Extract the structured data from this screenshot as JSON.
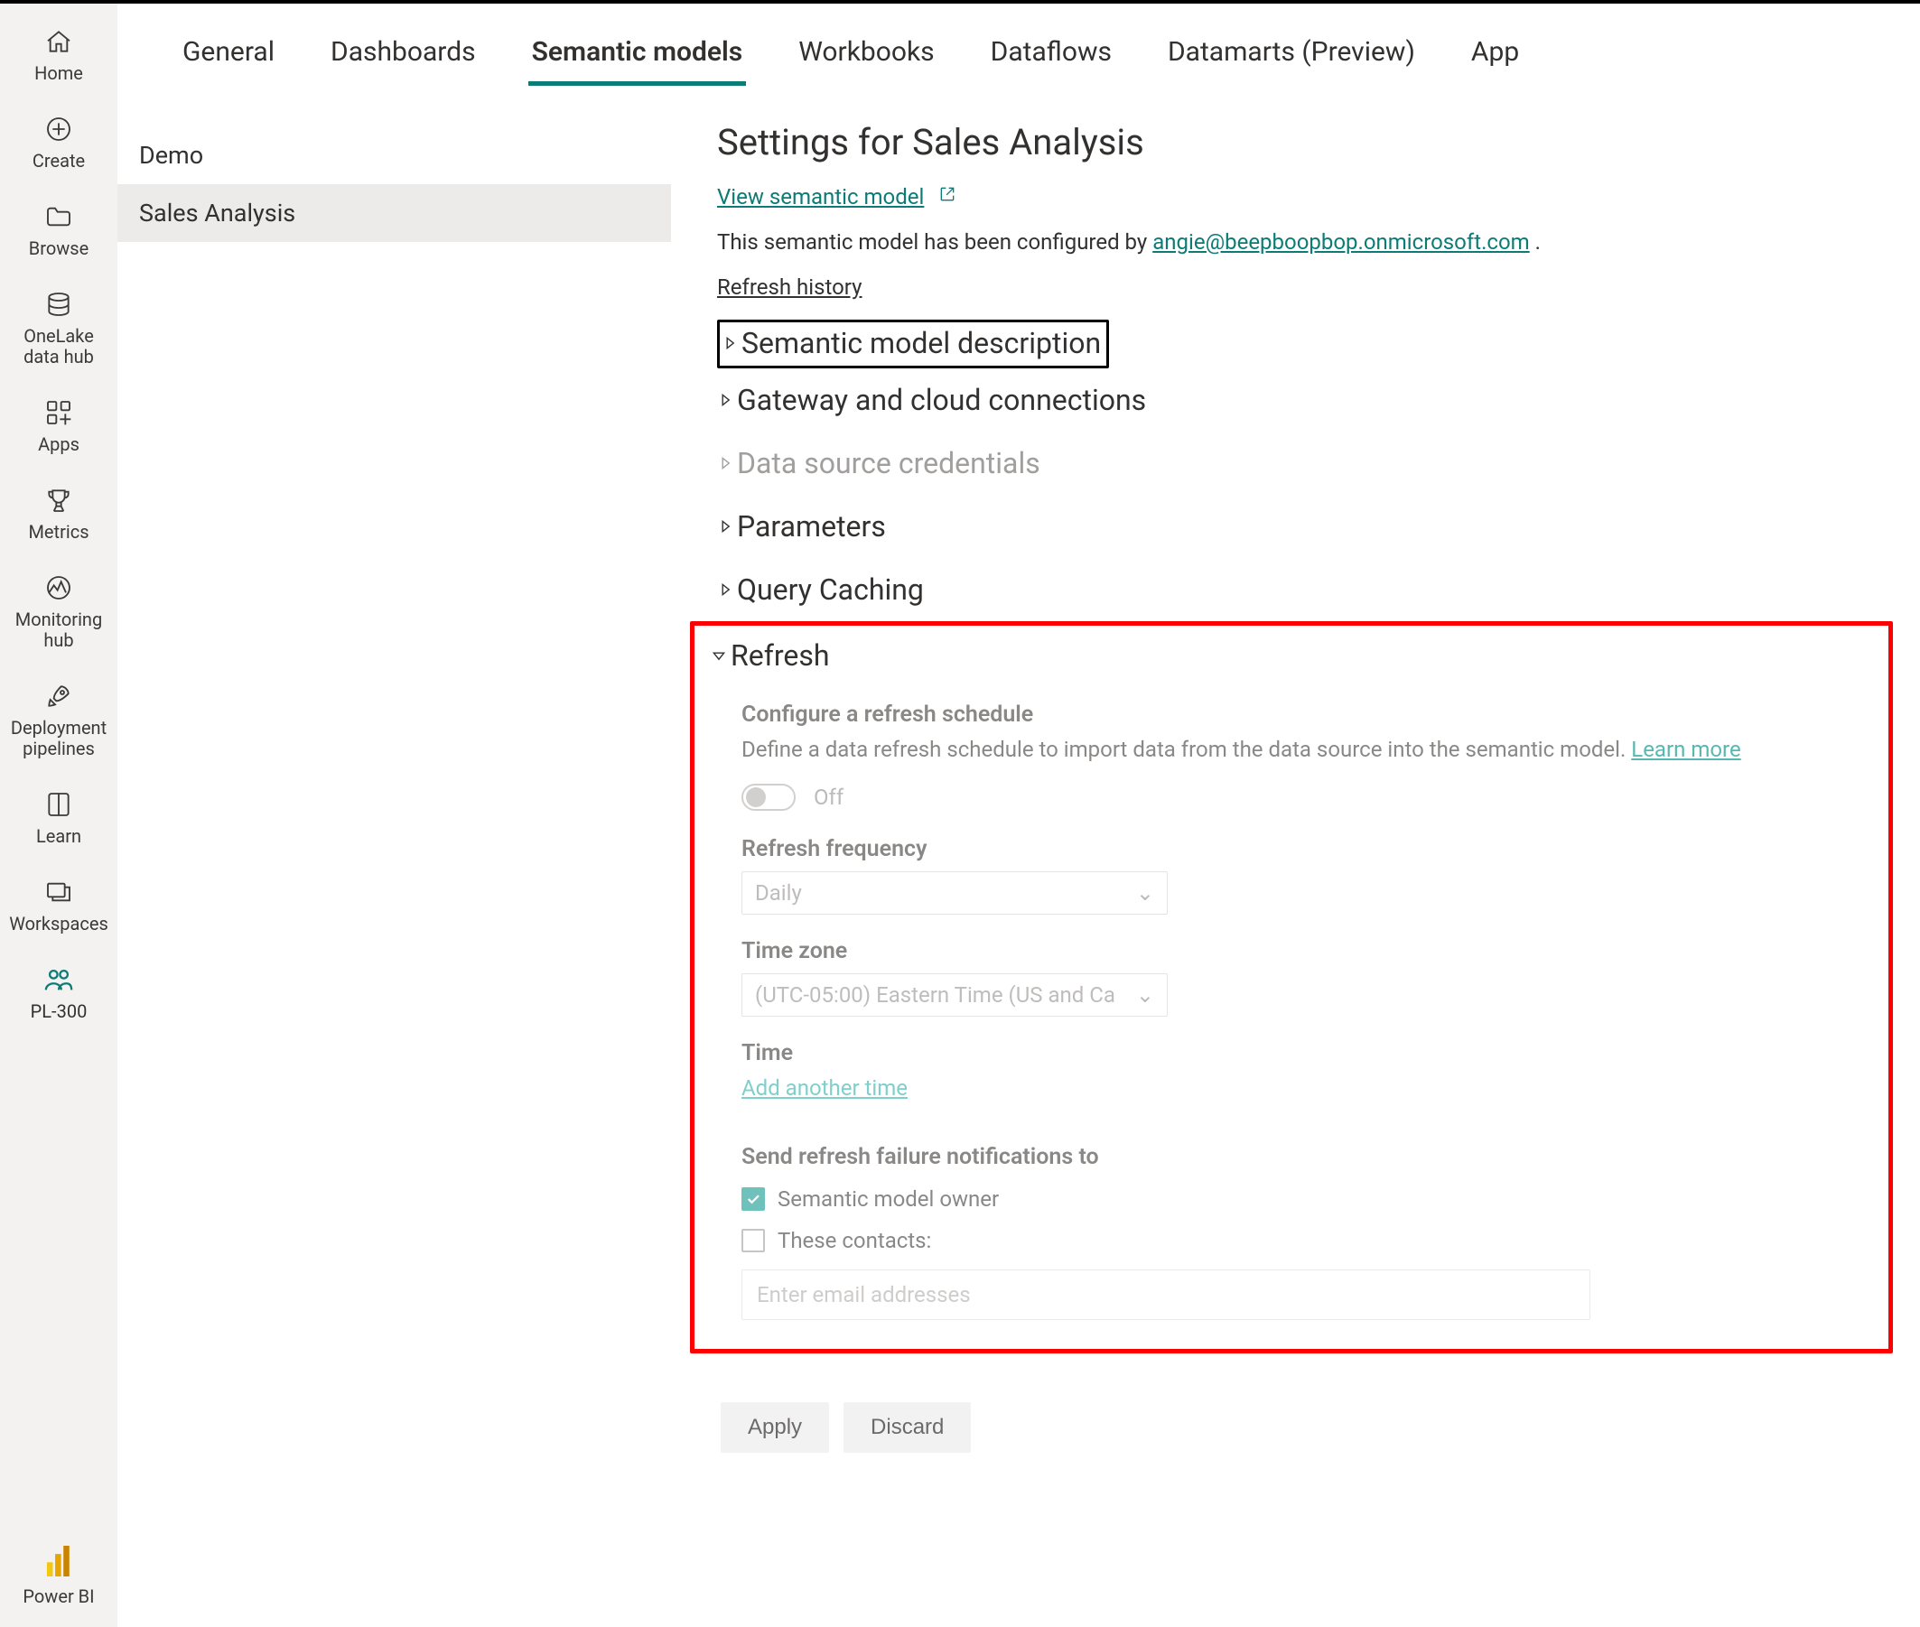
{
  "rail": {
    "items": [
      {
        "key": "home",
        "label": "Home"
      },
      {
        "key": "create",
        "label": "Create"
      },
      {
        "key": "browse",
        "label": "Browse"
      },
      {
        "key": "onelake",
        "label": "OneLake data hub"
      },
      {
        "key": "apps",
        "label": "Apps"
      },
      {
        "key": "metrics",
        "label": "Metrics"
      },
      {
        "key": "monitoring",
        "label": "Monitoring hub"
      },
      {
        "key": "deployment",
        "label": "Deployment pipelines"
      },
      {
        "key": "learn",
        "label": "Learn"
      },
      {
        "key": "workspaces",
        "label": "Workspaces"
      },
      {
        "key": "pl300",
        "label": "PL-300"
      }
    ],
    "brand_label": "Power BI"
  },
  "tabs": [
    {
      "key": "general",
      "label": "General"
    },
    {
      "key": "dashboards",
      "label": "Dashboards"
    },
    {
      "key": "semantic",
      "label": "Semantic models",
      "active": true
    },
    {
      "key": "workbooks",
      "label": "Workbooks"
    },
    {
      "key": "dataflows",
      "label": "Dataflows"
    },
    {
      "key": "datamarts",
      "label": "Datamarts (Preview)"
    },
    {
      "key": "app",
      "label": "App"
    }
  ],
  "list": {
    "items": [
      {
        "label": "Demo",
        "selected": false
      },
      {
        "label": "Sales Analysis",
        "selected": true
      }
    ]
  },
  "content": {
    "title": "Settings for Sales Analysis",
    "view_link": "View semantic model",
    "configured_prefix": "This semantic model has been configured by ",
    "configured_email": "angie@beepboopbop.onmicrosoft.com",
    "configured_suffix": ".",
    "refresh_history": "Refresh history",
    "sections": {
      "description": "Semantic model description",
      "gateway": "Gateway and cloud connections",
      "credentials": "Data source credentials",
      "parameters": "Parameters",
      "caching": "Query Caching",
      "refresh": "Refresh"
    },
    "refresh": {
      "schedule_heading": "Configure a refresh schedule",
      "schedule_desc": "Define a data refresh schedule to import data from the data source into the semantic model.  ",
      "learn_more": "Learn more",
      "toggle_state": "Off",
      "frequency_label": "Refresh frequency",
      "frequency_value": "Daily",
      "timezone_label": "Time zone",
      "timezone_value": "(UTC-05:00) Eastern Time (US and Ca",
      "time_label": "Time",
      "add_time": "Add another time",
      "notify_heading": "Send refresh failure notifications to",
      "notify_owner": "Semantic model owner",
      "notify_contacts": "These contacts:",
      "contacts_placeholder": "Enter email addresses"
    },
    "actions": {
      "apply": "Apply",
      "discard": "Discard"
    }
  }
}
